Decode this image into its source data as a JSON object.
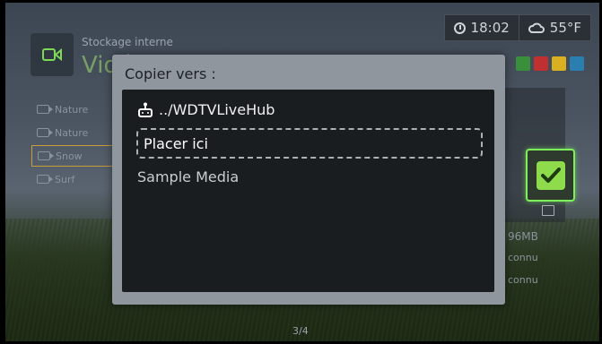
{
  "background": {
    "storage_label": "Stockage interne",
    "title": "Vidéo",
    "list_items": [
      "Nature",
      "Nature",
      "Snow",
      "Surf"
    ],
    "selected_index": 2,
    "time": "18:02",
    "temperature": "55°F",
    "storage_size": "96MB",
    "unknown_1": "connu",
    "unknown_2": "connu",
    "page_indicator": "3/4",
    "color_buttons": [
      "#3a8f3a",
      "#c03030",
      "#d8b020",
      "#2a7fb0"
    ]
  },
  "dialog": {
    "title": "Copier vers :",
    "items": {
      "hub_label": "../WDTVLiveHub",
      "place_label": "Placer ici",
      "sample_label": "Sample Media"
    }
  },
  "accent_color": "#7ef05a"
}
